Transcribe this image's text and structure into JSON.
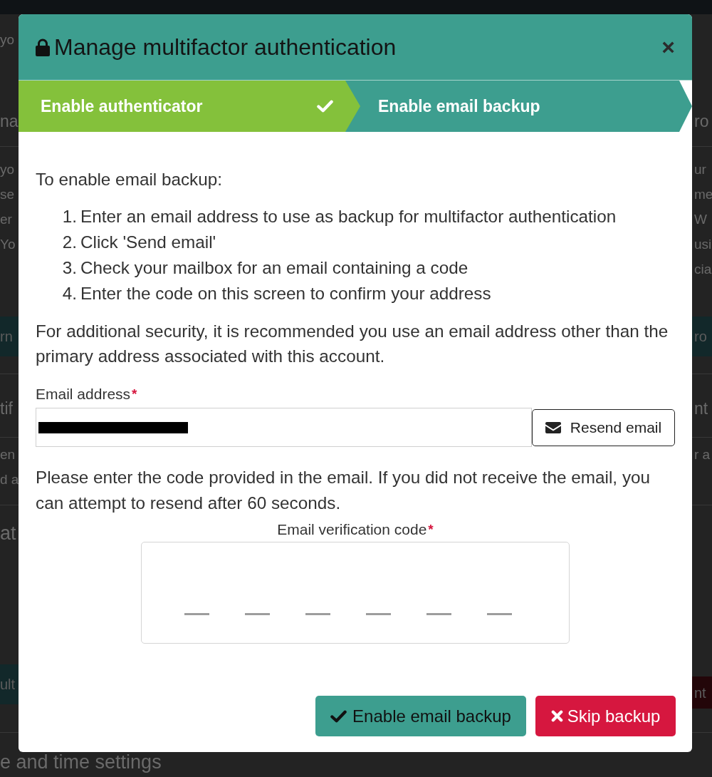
{
  "background_page": {
    "rows": [
      {
        "kind": "text",
        "left": "yo"
      },
      {
        "kind": "heading",
        "left": "na",
        "right": "ro"
      },
      {
        "kind": "text",
        "left": "yo",
        "right": "ur"
      },
      {
        "kind": "text",
        "left": "se",
        "right": "me"
      },
      {
        "kind": "text",
        "left": "er",
        "right": "W"
      },
      {
        "kind": "text",
        "left": "Yo",
        "right": "usi"
      },
      {
        "kind": "text",
        "right": "cia"
      },
      {
        "kind": "band",
        "left": "rn",
        "right": "ro"
      },
      {
        "kind": "heading",
        "left": "tif",
        "right": "nt"
      },
      {
        "kind": "text",
        "left": "en",
        "right": "r a"
      },
      {
        "kind": "text",
        "left": "d a"
      },
      {
        "kind": "title",
        "left": "at"
      },
      {
        "kind": "band",
        "left": "ult",
        "right": "nt",
        "right_danger": true
      },
      {
        "kind": "title",
        "left": "e and time settings"
      }
    ]
  },
  "dialog": {
    "title": "Manage multifactor authentication",
    "close": "×",
    "steps": [
      {
        "label": "Enable authenticator",
        "completed": true,
        "selected": false
      },
      {
        "label": "Enable email backup",
        "completed": false,
        "selected": true
      }
    ],
    "intro": "To enable email backup:",
    "instructions": [
      {
        "number": "1.",
        "text": "Enter an email address to use as backup for multifactor authentication"
      },
      {
        "number": "2.",
        "text": "Click 'Send email'"
      },
      {
        "number": "3.",
        "text": "Check your mailbox for an email containing a code"
      },
      {
        "number": "4.",
        "text": "Enter the code on this screen to confirm your address"
      }
    ],
    "security_note": "For additional security, it is recommended you use an email address other than the primary address associated with this account.",
    "email_field": {
      "label": "Email address",
      "required_mark": "*",
      "redacted": true
    },
    "resend_button": "Resend email",
    "code_note": "Please enter the code provided in the email. If you did not receive the email, you can attempt to resend after 60 seconds.",
    "code_field": {
      "label": "Email verification code",
      "required_mark": "*"
    },
    "buttons": [
      {
        "kind": "confirm",
        "label": "Enable email backup"
      },
      {
        "kind": "cancel",
        "label": "Skip backup"
      }
    ]
  }
}
